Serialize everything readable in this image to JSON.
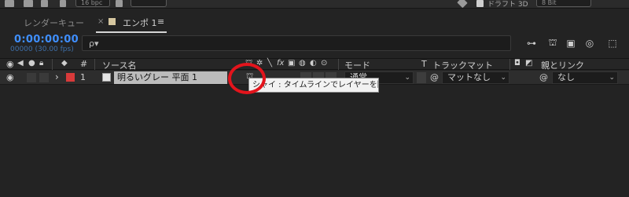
{
  "toolbar": {
    "bpc": "16 bpc",
    "draft_label": "ドラフト 3D",
    "bit": "8 Bit"
  },
  "tabs": {
    "render_queue": "レンダーキュー",
    "close_mark": "×",
    "comp": "エンポ 1",
    "menu_icon": "≡"
  },
  "timeline": {
    "timecode": "0:00:00:00",
    "fps": "00000 (30.00 fps)",
    "search_placeholder": "",
    "search_icon": "ρ▾"
  },
  "header": {
    "hash": "#",
    "source_name": "ソース名",
    "mode": "モード",
    "t": "T",
    "track_matte": "トラックマット",
    "parent_link": "親とリンク"
  },
  "layer": {
    "number": "1",
    "expand": "›",
    "name": "明るいグレー 平面 1",
    "mode": "通常",
    "matte": "マットなし",
    "parent": "なし"
  },
  "tooltip": {
    "text": "シャイ : タイムラインでレイヤーを隠す"
  },
  "colors": {
    "timecode": "#3f8fff",
    "label_red": "#d83a3a",
    "annotation": "#e3141c"
  }
}
